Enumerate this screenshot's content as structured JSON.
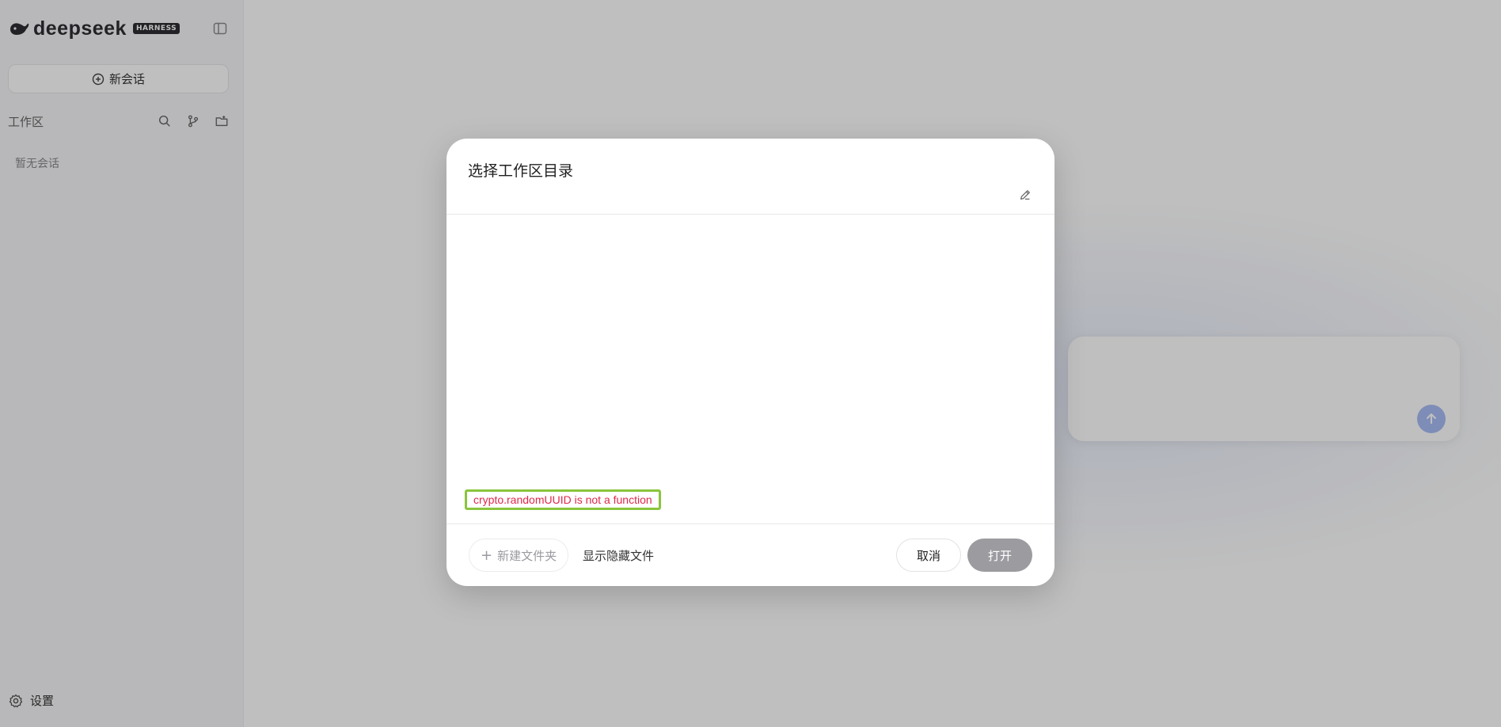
{
  "app": {
    "brand_name": "deepseek",
    "brand_badge": "HARNESS"
  },
  "sidebar": {
    "new_chat_label": "新会话",
    "workspace_title": "工作区",
    "workspace_empty": "暂无会话",
    "settings_label": "设置"
  },
  "dialog": {
    "title": "选择工作区目录",
    "error_message": "crypto.randomUUID is not a function",
    "new_folder_label": "新建文件夹",
    "show_hidden_label": "显示隐藏文件",
    "cancel_label": "取消",
    "open_label": "打开"
  },
  "colors": {
    "error_text": "#e0294a",
    "error_highlight": "#8ac53c",
    "send_button": "#a9bdf5",
    "open_button_disabled": "#9c9ca0"
  }
}
